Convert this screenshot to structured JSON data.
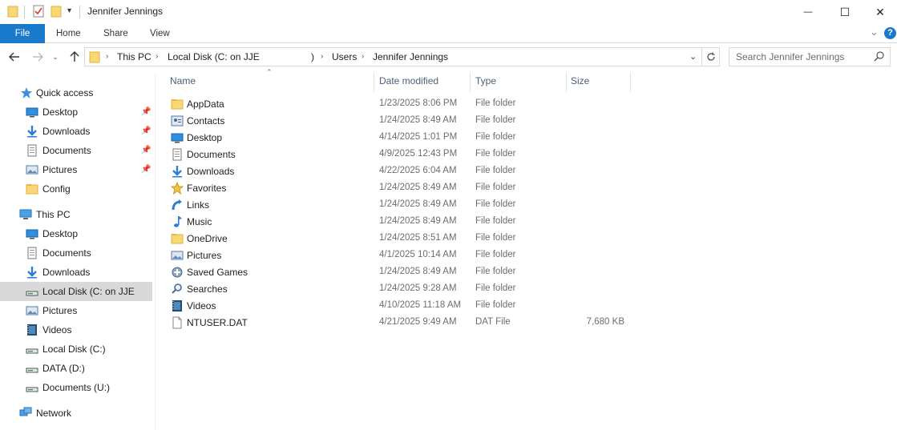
{
  "window": {
    "title": "Jennifer Jennings",
    "minimize_glyph": "—",
    "maximize_glyph": "☐",
    "close_glyph": "✕"
  },
  "ribbon": {
    "tabs": [
      "File",
      "Home",
      "Share",
      "View"
    ],
    "help_glyph": "?",
    "expand_glyph": "⌄"
  },
  "address": {
    "crumbs": [
      "This PC",
      "Local Disk (C: on JJE",
      ")",
      "Users",
      "Jennifer Jennings"
    ],
    "search_placeholder": "Search Jennifer Jennings"
  },
  "nav": {
    "quick_access_label": "Quick access",
    "quick_items": [
      "Desktop",
      "Downloads",
      "Documents",
      "Pictures",
      "Config"
    ],
    "this_pc_label": "This PC",
    "pc_items": [
      "Desktop",
      "Documents",
      "Downloads",
      "Local Disk (C: on JJE",
      "Pictures",
      "Videos",
      "Local Disk (C:)",
      "DATA (D:)",
      "Documents (U:)"
    ],
    "network_label": "Network"
  },
  "columns": {
    "name": "Name",
    "date": "Date modified",
    "type": "Type",
    "size": "Size"
  },
  "files": [
    {
      "name": "AppData",
      "date": "1/23/2025 8:06 PM",
      "type": "File folder",
      "size": "",
      "icon": "folder"
    },
    {
      "name": "Contacts",
      "date": "1/24/2025 8:49 AM",
      "type": "File folder",
      "size": "",
      "icon": "contacts"
    },
    {
      "name": "Desktop",
      "date": "4/14/2025 1:01 PM",
      "type": "File folder",
      "size": "",
      "icon": "desktop"
    },
    {
      "name": "Documents",
      "date": "4/9/2025 12:43 PM",
      "type": "File folder",
      "size": "",
      "icon": "documents"
    },
    {
      "name": "Downloads",
      "date": "4/22/2025 6:04 AM",
      "type": "File folder",
      "size": "",
      "icon": "downloads"
    },
    {
      "name": "Favorites",
      "date": "1/24/2025 8:49 AM",
      "type": "File folder",
      "size": "",
      "icon": "favorites"
    },
    {
      "name": "Links",
      "date": "1/24/2025 8:49 AM",
      "type": "File folder",
      "size": "",
      "icon": "links"
    },
    {
      "name": "Music",
      "date": "1/24/2025 8:49 AM",
      "type": "File folder",
      "size": "",
      "icon": "music"
    },
    {
      "name": "OneDrive",
      "date": "1/24/2025 8:51 AM",
      "type": "File folder",
      "size": "",
      "icon": "folder"
    },
    {
      "name": "Pictures",
      "date": "4/1/2025 10:14 AM",
      "type": "File folder",
      "size": "",
      "icon": "pictures"
    },
    {
      "name": "Saved Games",
      "date": "1/24/2025 8:49 AM",
      "type": "File folder",
      "size": "",
      "icon": "saved-games"
    },
    {
      "name": "Searches",
      "date": "1/24/2025 9:28 AM",
      "type": "File folder",
      "size": "",
      "icon": "searches"
    },
    {
      "name": "Videos",
      "date": "4/10/2025 11:18 AM",
      "type": "File folder",
      "size": "",
      "icon": "videos"
    },
    {
      "name": "NTUSER.DAT",
      "date": "4/21/2025 9:49 AM",
      "type": "DAT File",
      "size": "7,680 KB",
      "icon": "file"
    }
  ],
  "colors": {
    "accent": "#1979ca",
    "folder": "#f8d775",
    "selection": "#d9d9d9",
    "header_text": "#4c607a"
  }
}
